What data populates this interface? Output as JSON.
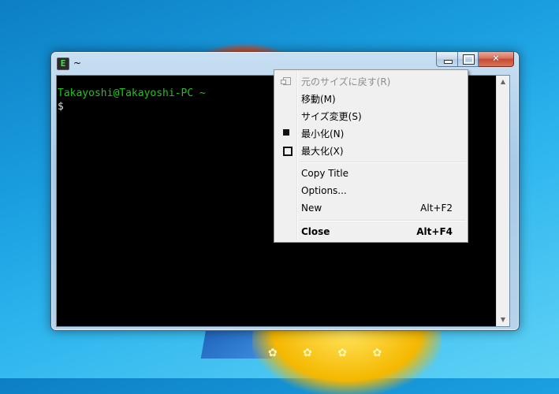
{
  "window": {
    "title": "~",
    "app_icon_glyph": "E",
    "close_glyph": "✕"
  },
  "terminal": {
    "prompt_line": "Takayoshi@Takayoshi-PC ~",
    "input_line": "$"
  },
  "context_menu": {
    "items": [
      {
        "label": "元のサイズに戻す(R)",
        "accel": "",
        "disabled": true,
        "icon": "restore-icon"
      },
      {
        "label": "移動(M)",
        "accel": ""
      },
      {
        "label": "サイズ変更(S)",
        "accel": ""
      },
      {
        "label": "最小化(N)",
        "accel": "",
        "icon": "minimize-icon"
      },
      {
        "label": "最大化(X)",
        "accel": "",
        "icon": "maximize-icon"
      },
      {
        "label": "Copy Title",
        "accel": ""
      },
      {
        "label": "Options...",
        "accel": ""
      },
      {
        "label": "New",
        "accel": "Alt+F2"
      },
      {
        "label": "Close",
        "accel": "Alt+F4",
        "bold": true
      }
    ]
  },
  "colors": {
    "prompt_green": "#1fc41f",
    "terminal_bg": "#000000",
    "menu_bg": "#f0f0f0"
  },
  "desktop": {
    "stars": "✿ ✿ ✿ ✿"
  }
}
